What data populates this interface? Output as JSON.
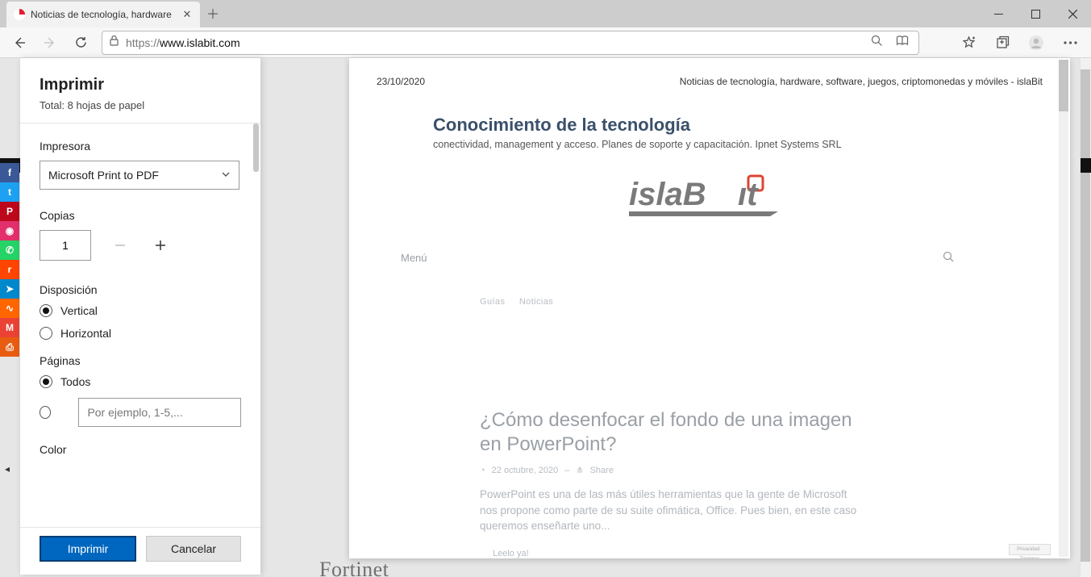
{
  "browser": {
    "tab_title": "Noticias de tecnología, hardware",
    "url_scheme": "https://",
    "url_host": "www.islabit.com"
  },
  "print": {
    "title": "Imprimir",
    "subtitle": "Total: 8 hojas de papel",
    "printer_label": "Impresora",
    "printer_value": "Microsoft Print to PDF",
    "copies_label": "Copias",
    "copies_value": "1",
    "layout_label": "Disposición",
    "layout_portrait": "Vertical",
    "layout_landscape": "Horizontal",
    "pages_label": "Páginas",
    "pages_all": "Todos",
    "pages_placeholder": "Por ejemplo, 1-5,...",
    "color_label": "Color",
    "btn_print": "Imprimir",
    "btn_cancel": "Cancelar"
  },
  "preview": {
    "date": "23/10/2020",
    "header": "Noticias de tecnología, hardware, software, juegos, criptomonedas y móviles - islaBit",
    "ad_title": "Conocimiento de la tecnología",
    "ad_sub": "conectividad, management y acceso. Planes de soporte y capacitación. Ipnet Systems SRL",
    "menu": "Menú",
    "crumb1": "Guías",
    "crumb2": "Noticias",
    "article_title": "¿Cómo desenfocar el fondo de una imagen en PowerPoint?",
    "article_date": "22 octubre, 2020",
    "article_share": "Share",
    "article_body": "PowerPoint es una de las más útiles herramientas que la gente de Microsoft nos propone como parte de su suite ofimática, Office. Pues bien, en este caso queremos enseñarte uno...",
    "read_more": "Leelo ya!",
    "below_word": "Fortinet"
  },
  "social": {
    "items": [
      {
        "bg": "#3b5998",
        "t": "f"
      },
      {
        "bg": "#1da1f2",
        "t": "t"
      },
      {
        "bg": "#bd081c",
        "t": "P"
      },
      {
        "bg": "#e1306c",
        "t": "◉"
      },
      {
        "bg": "#25d366",
        "t": "✆"
      },
      {
        "bg": "#ff4500",
        "t": "r"
      },
      {
        "bg": "#0088cc",
        "t": "➤"
      },
      {
        "bg": "#ff6600",
        "t": "∿"
      },
      {
        "bg": "#ea4335",
        "t": "M"
      },
      {
        "bg": "#e85c12",
        "t": "⎙"
      }
    ]
  }
}
